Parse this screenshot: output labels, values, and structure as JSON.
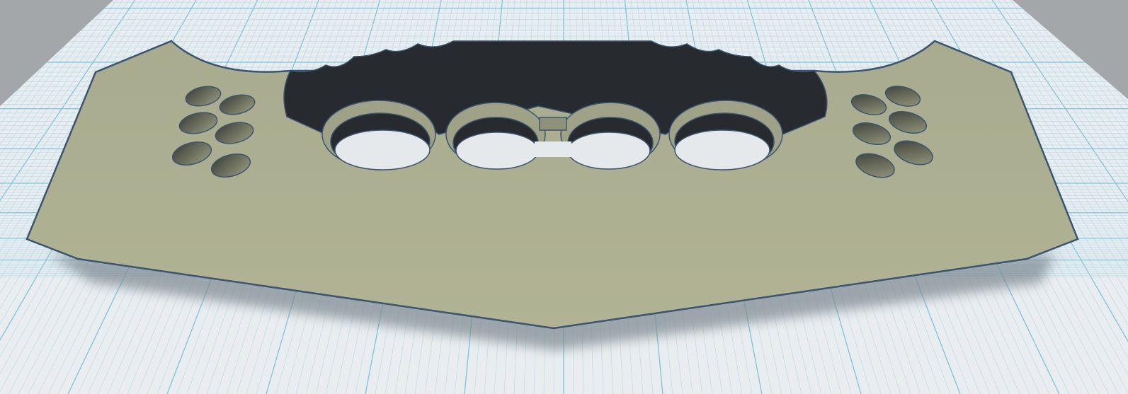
{
  "viewport": {
    "colors": {
      "background": "#a3a7a9",
      "workplane": "#e9edef",
      "grid_minor": "#b9dcea",
      "grid_major": "#7cc3df",
      "plate": "#aeb192",
      "plate_edge": "#3b5570",
      "knuckle": "#272b2f",
      "shadow": "#7d8890"
    }
  }
}
